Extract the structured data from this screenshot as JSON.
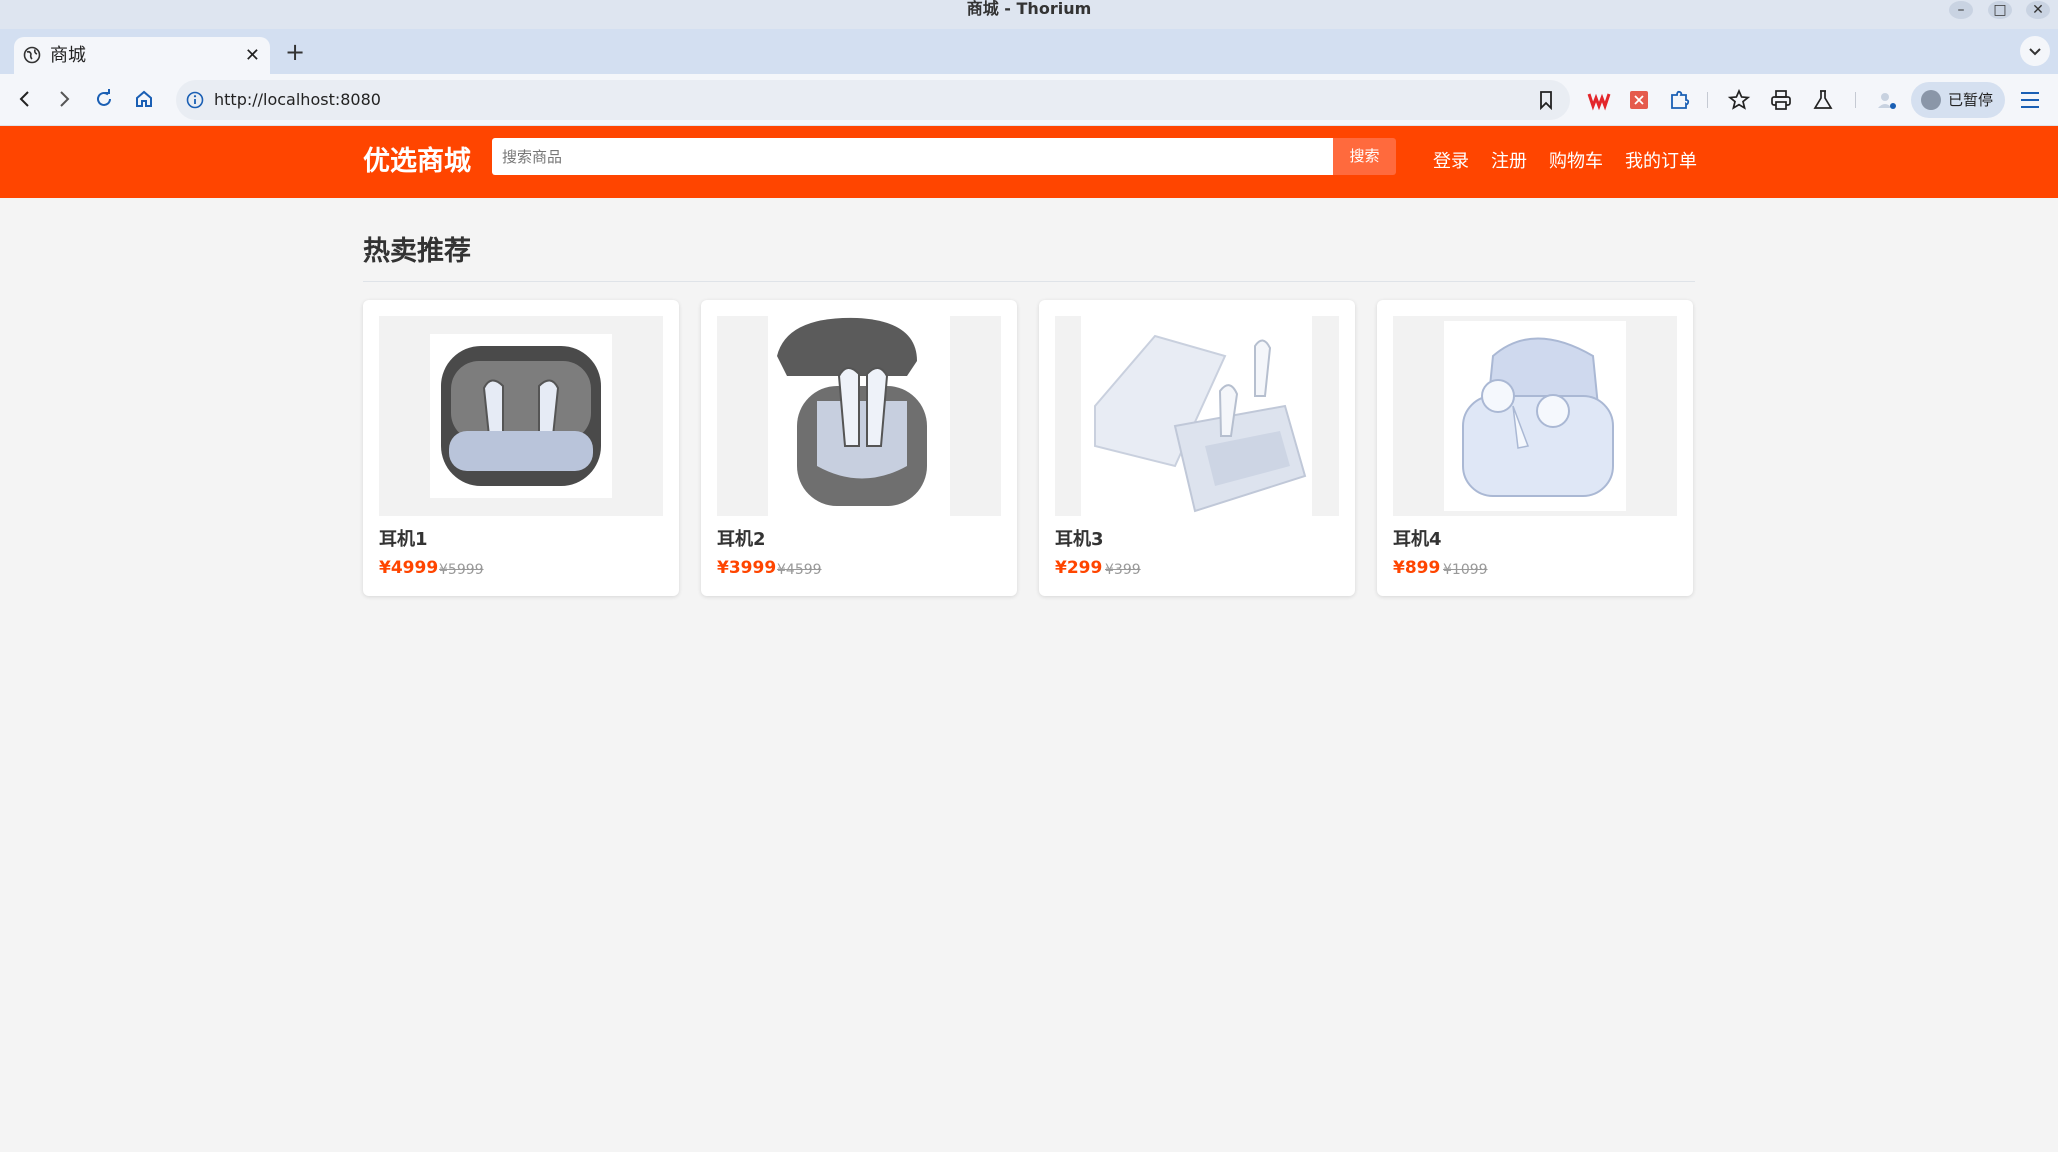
{
  "window": {
    "title": "商城 - Thorium"
  },
  "tabs": [
    {
      "label": "商城"
    }
  ],
  "address_bar": {
    "url": "http://localhost:8080"
  },
  "profile": {
    "label": "已暂停"
  },
  "site": {
    "logo": "优选商城",
    "search": {
      "placeholder": "搜索商品",
      "button": "搜索"
    },
    "nav": [
      "登录",
      "注册",
      "购物车",
      "我的订单"
    ]
  },
  "section": {
    "title": "热卖推荐"
  },
  "products": [
    {
      "name": "耳机1",
      "price": "¥4999",
      "original_price": "¥5999",
      "image": "earbuds-dark-case"
    },
    {
      "name": "耳机2",
      "price": "¥3999",
      "original_price": "¥4599",
      "image": "earbuds-open-lid-dark"
    },
    {
      "name": "耳机3",
      "price": "¥299",
      "original_price": "¥399",
      "image": "earbuds-white-open"
    },
    {
      "name": "耳机4",
      "price": "¥899",
      "original_price": "¥1099",
      "image": "earbuds-light-blue-case"
    }
  ],
  "colors": {
    "brand": "#ff4500",
    "search_button": "#ff6a3d",
    "page_bg": "#f4f4f4"
  }
}
